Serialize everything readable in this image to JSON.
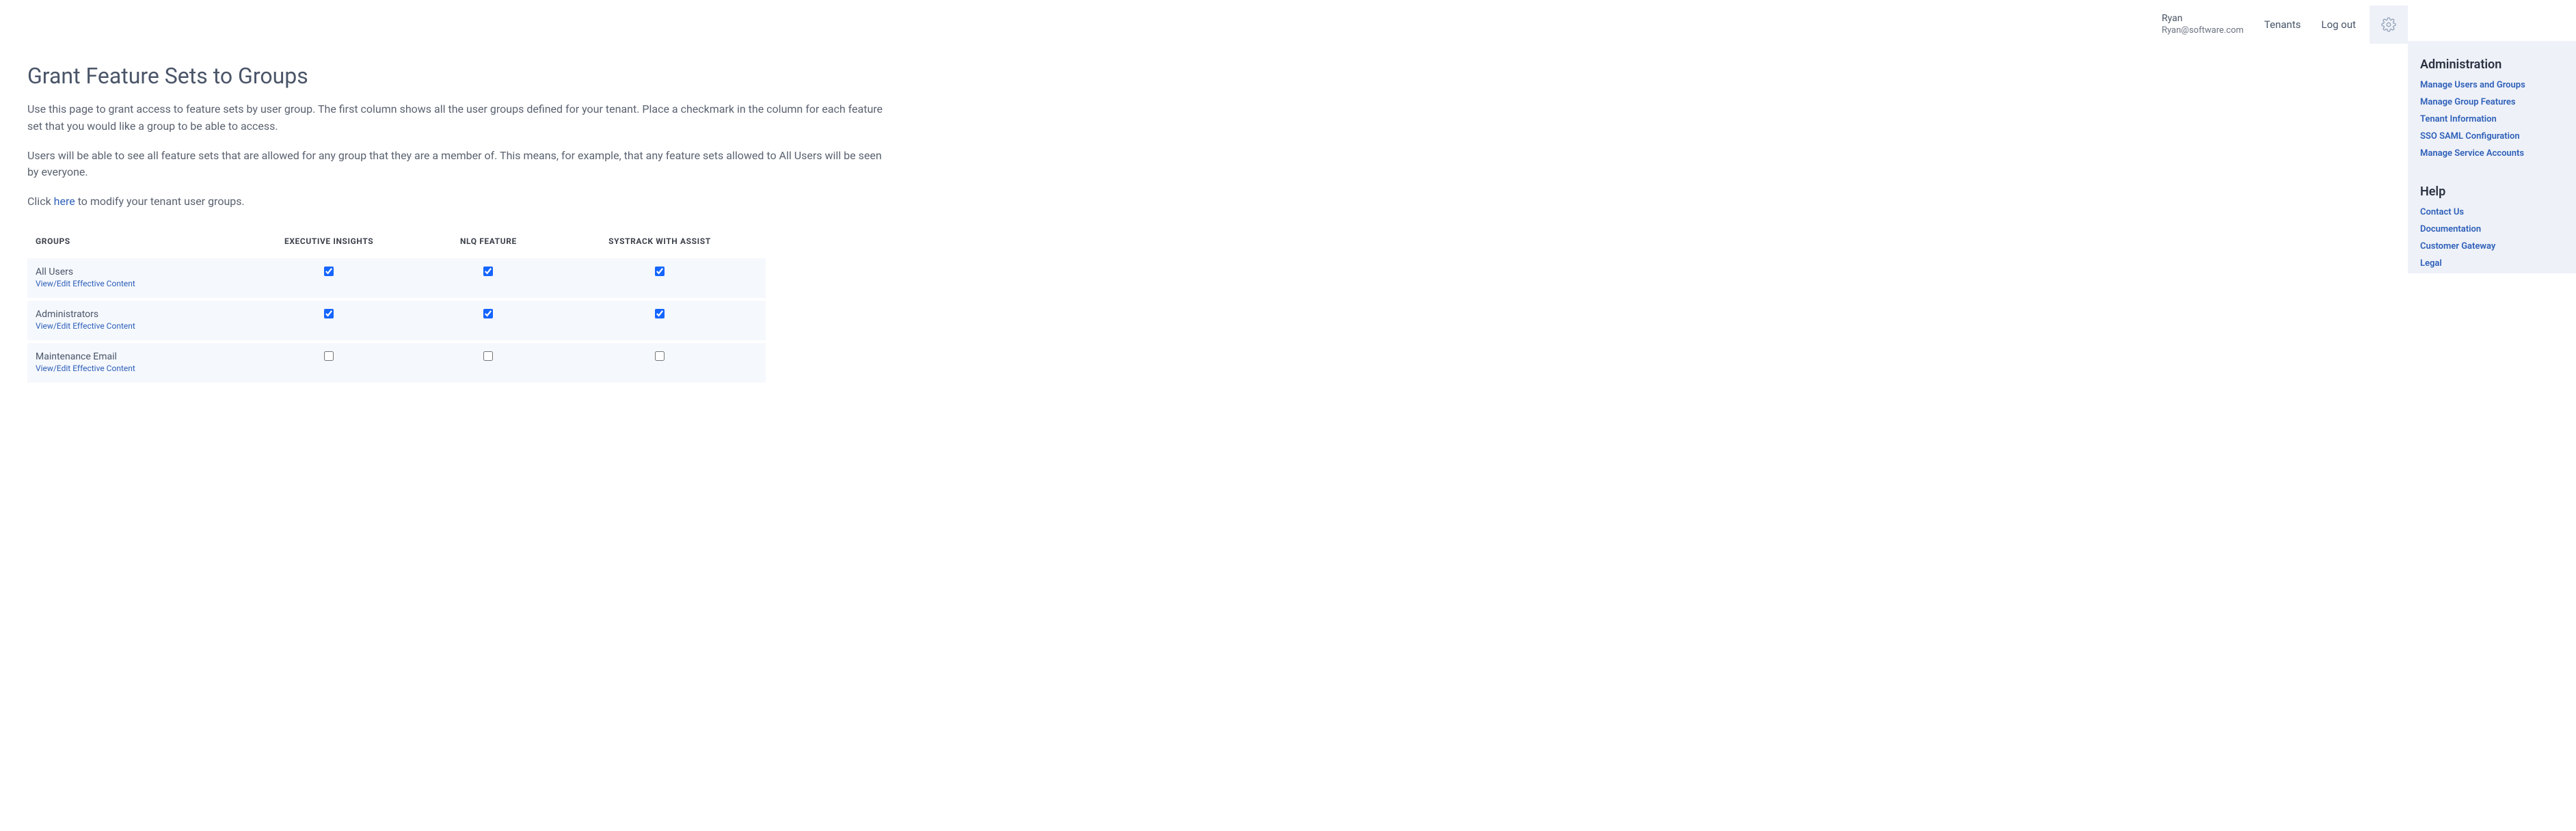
{
  "topbar": {
    "user": {
      "name": "Ryan",
      "email": "Ryan@software.com"
    },
    "tenants_label": "Tenants",
    "logout_label": "Log out"
  },
  "header": {
    "title": "Grant Feature Sets to Groups",
    "desc1": "Use this page to grant access to feature sets by user group. The first column shows all the user groups defined for your tenant. Place a checkmark in the column for each feature set that you would like a group to be able to access.",
    "desc2": "Users will be able to see all feature sets that are allowed for any group that they are a member of. This means, for example, that any feature sets allowed to All Users will be seen by everyone.",
    "desc3_prefix": "Click ",
    "desc3_link": "here",
    "desc3_suffix": " to modify your tenant user groups."
  },
  "table": {
    "headers": {
      "groups": "GROUPS",
      "col1": "EXECUTIVE INSIGHTS",
      "col2": "NLQ FEATURE",
      "col3": "SYSTRACK WITH ASSIST"
    },
    "view_edit_label": "View/Edit Effective Content",
    "rows": [
      {
        "name": "All Users",
        "checks": [
          true,
          true,
          true
        ]
      },
      {
        "name": "Administrators",
        "checks": [
          true,
          true,
          true
        ]
      },
      {
        "name": "Maintenance Email",
        "checks": [
          false,
          false,
          false
        ]
      }
    ]
  },
  "sidebar": {
    "admin_title": "Administration",
    "admin_links": [
      "Manage Users and Groups",
      "Manage Group Features",
      "Tenant Information",
      "SSO SAML Configuration",
      "Manage Service Accounts"
    ],
    "help_title": "Help",
    "help_links": [
      "Contact Us",
      "Documentation",
      "Customer Gateway",
      "Legal"
    ]
  }
}
